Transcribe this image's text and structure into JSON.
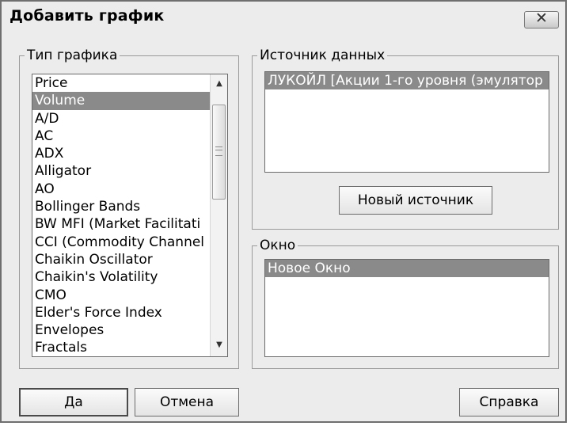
{
  "window": {
    "title": "Добавить график"
  },
  "chart_type": {
    "legend": "Тип графика",
    "items": [
      "Price",
      "Volume",
      "A/D",
      "AC",
      "ADX",
      "Alligator",
      "AO",
      "Bollinger Bands",
      "BW MFI (Market Facilitati",
      "CCI (Commodity Channel I",
      "Chaikin Oscillator",
      "Chaikin's Volatility",
      "CMO",
      "Elder's Force Index",
      "Envelopes",
      "Fractals"
    ],
    "selected_index": 1
  },
  "data_source": {
    "legend": "Источник данных",
    "items": [
      "ЛУКОЙЛ [Акции 1-го уровня (эмулятор"
    ],
    "new_source_button": "Новый источник"
  },
  "window_group": {
    "legend": "Окно",
    "items": [
      "Новое Окно"
    ]
  },
  "buttons": {
    "ok": "Да",
    "cancel": "Отмена",
    "help": "Справка"
  }
}
